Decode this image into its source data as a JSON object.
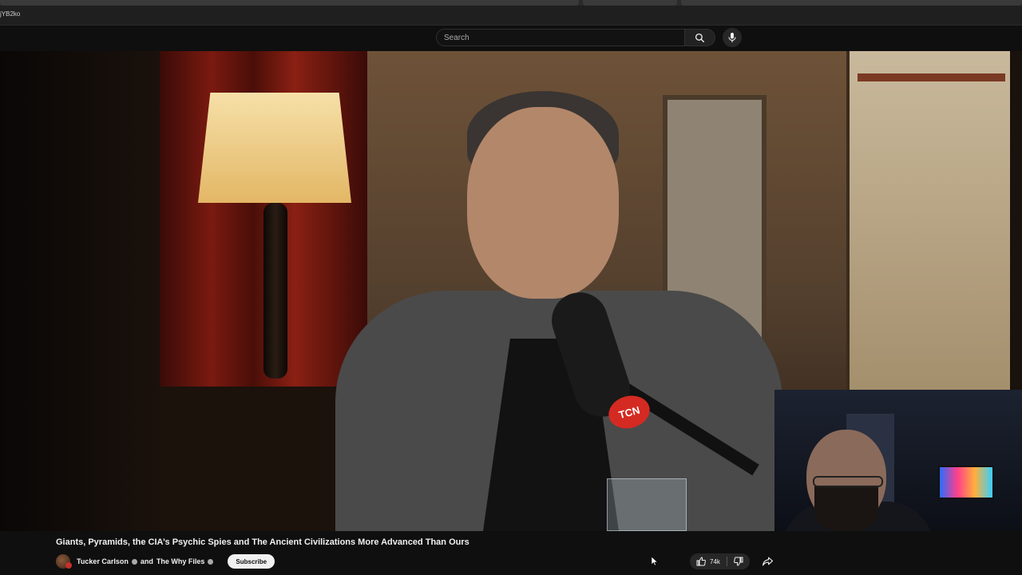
{
  "browser": {
    "url_fragment": "jYB2ko"
  },
  "header": {
    "search": {
      "placeholder": "Search",
      "value": ""
    },
    "icons": {
      "search": "search-icon",
      "mic": "mic-icon"
    }
  },
  "video": {
    "title": "Giants, Pyramids, the CIA’s Psychic Spies and The Ancient Civilizations More Advanced Than Ours",
    "logo_text": "TCN",
    "channel": "Tucker Carlson",
    "collab_separator": "and",
    "collaborator": "The Why Files",
    "subscribe_label": "Subscribe",
    "likes": "74k"
  },
  "colors": {
    "background": "#0f0f0f",
    "subscribe_bg": "#f1f1f1",
    "tcn_red": "#d42a22"
  }
}
